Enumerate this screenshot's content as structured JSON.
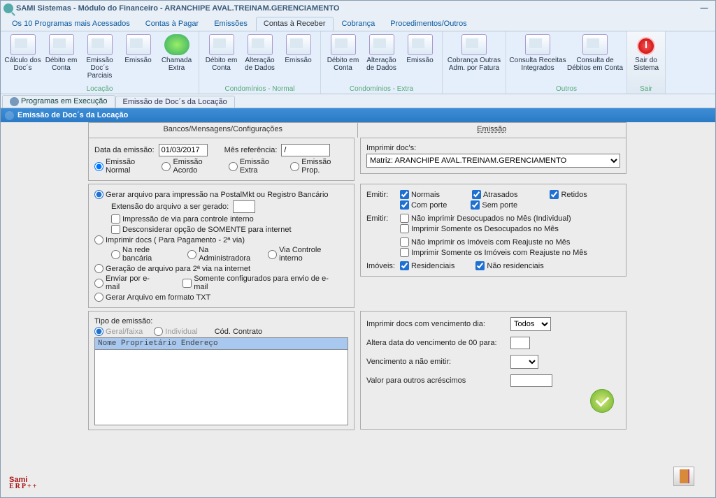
{
  "window_title": "SAMI Sistemas - Módulo do Financeiro - ARANCHIPE AVAL.TREINAM.GERENCIAMENTO",
  "menu": [
    "Os 10 Programas mais Acessados",
    "Contas à Pagar",
    "Emissões",
    "Contas à Receber",
    "Cobrança",
    "Procedimentos/Outros"
  ],
  "menu_active": 3,
  "ribbon": {
    "g1": {
      "label": "Locação",
      "items": [
        "Cálculo dos Doc´s",
        "Débito em Conta",
        "Emissão Doc´s Parciais",
        "Emissão",
        "Chamada Extra"
      ]
    },
    "g2": {
      "label": "Condomínios - Normal",
      "items": [
        "Débito em Conta",
        "Alteração de Dados",
        "Emissão"
      ]
    },
    "g3": {
      "label": "Condomínios - Extra",
      "items": [
        "Débito em Conta",
        "Alteração de Dados",
        "Emissão"
      ]
    },
    "g4": {
      "label": "",
      "items": [
        "Cobrança Outras Adm. por Fatura"
      ]
    },
    "g5": {
      "label": "Outros",
      "items": [
        "Consulta Receitas Integrados",
        "Consulta de Débitos em Conta"
      ]
    },
    "sair": {
      "label": "Sair",
      "item": "Sair do Sistema"
    }
  },
  "strip": [
    "Programas em Execução",
    "Emissão de Doc´s da Locação"
  ],
  "section_header": "Emissão de Doc´s da Locação",
  "tabs": [
    "Bancos/Mensagens/Configurações",
    "Emissão"
  ],
  "form": {
    "data_emissao_lbl": "Data da emissão:",
    "data_emissao_val": "01/03/2017",
    "mes_ref_lbl": "Mês referência:",
    "mes_ref_val": "/",
    "tipo_emissao": [
      "Emissão Normal",
      "Emissão Acordo",
      "Emissão Extra",
      "Emissão Prop."
    ],
    "imprimir_docs_lbl": "Imprimir doc's:",
    "imprimir_docs_val": "Matriz: ARANCHIPE AVAL.TREINAM.GERENCIAMENTO",
    "gen": {
      "r1": "Gerar arquivo para impressão na PostalMkt ou Registro Bancário",
      "ext_lbl": "Extensão do arquivo a ser gerado:",
      "c1": "Impressão de via para controle interno",
      "c2": "Desconsiderar opção de SOMENTE para internet",
      "r2": "Imprimir docs ( Para Pagamento -  2ª via)",
      "r2a": "Na rede bancária",
      "r2b": "Na Administradora",
      "r2c": "Via Controle interno",
      "r3": "Geração de  arquivo para 2ª via na internet",
      "r4": "Enviar por e-mail",
      "c3": "Somente configurados para envio de e-mail",
      "r5": "Gerar Arquivo em formato TXT"
    },
    "emitir": {
      "lbl": "Emitir:",
      "normais": "Normais",
      "atrasados": "Atrasados",
      "retidos": "Retidos",
      "comporte": "Com porte",
      "semporte": "Sem porte",
      "naoimp": "Não imprimir Desocupados no Mês (Individual)",
      "impsom": "Imprimir Somente os Desocupados no Mês",
      "naoreaj": "Não imprimir os Imóveis com Reajuste no Mês",
      "impreaj": "Imprimir Somente os Imóveis com Reajuste no Mês"
    },
    "imoveis": {
      "lbl": "Imóveis:",
      "res": "Residenciais",
      "nres": "Não residenciais"
    },
    "tipo_box": {
      "lbl": "Tipo de emissão:",
      "geral": "Geral/faixa",
      "indiv": "Individual",
      "cod": "Cód. Contrato"
    },
    "grid_head": "Nome Proprietário      Endereço",
    "right2": {
      "venc_dia": "Imprimir docs com vencimento dia:",
      "venc_val": "Todos",
      "altera": "Altera data do vencimento de 00 para:",
      "venc_nao": "Vencimento a não emitir:",
      "valor": "Valor para outros acréscimos"
    }
  },
  "logo": {
    "brand": "Sami",
    "sub": "ERP++"
  }
}
